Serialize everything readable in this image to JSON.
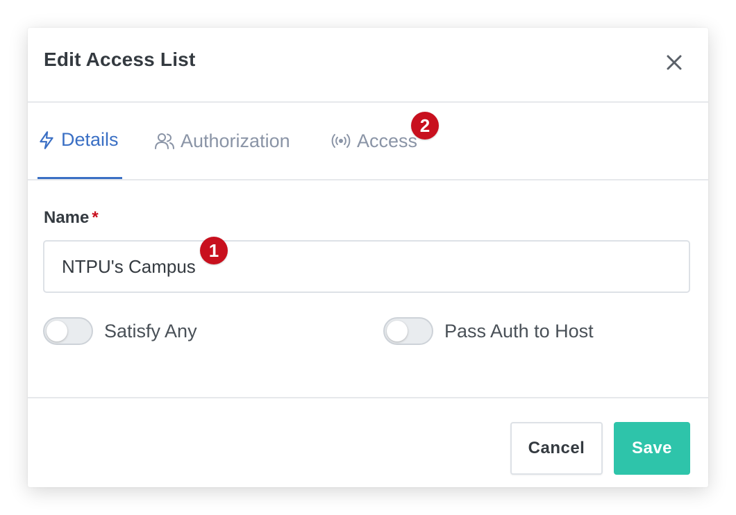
{
  "dialog": {
    "title": "Edit Access List",
    "close_icon": "close-icon"
  },
  "tabs": [
    {
      "label": "Details",
      "icon": "lightning-icon",
      "active": true
    },
    {
      "label": "Authorization",
      "icon": "users-icon",
      "active": false
    },
    {
      "label": "Access",
      "icon": "broadcast-icon",
      "active": false
    }
  ],
  "form": {
    "name_label": "Name",
    "required_marker": "*",
    "name_value": "NTPU's Campus",
    "toggles": [
      {
        "label": "Satisfy Any",
        "on": false
      },
      {
        "label": "Pass Auth to Host",
        "on": false
      }
    ]
  },
  "annotations": [
    {
      "number": "1"
    },
    {
      "number": "2"
    }
  ],
  "footer": {
    "cancel_label": "Cancel",
    "save_label": "Save"
  },
  "colors": {
    "accent": "#3a6fc4",
    "save_button": "#2ec4aa",
    "badge": "#c8101e",
    "required": "#c8101e"
  }
}
